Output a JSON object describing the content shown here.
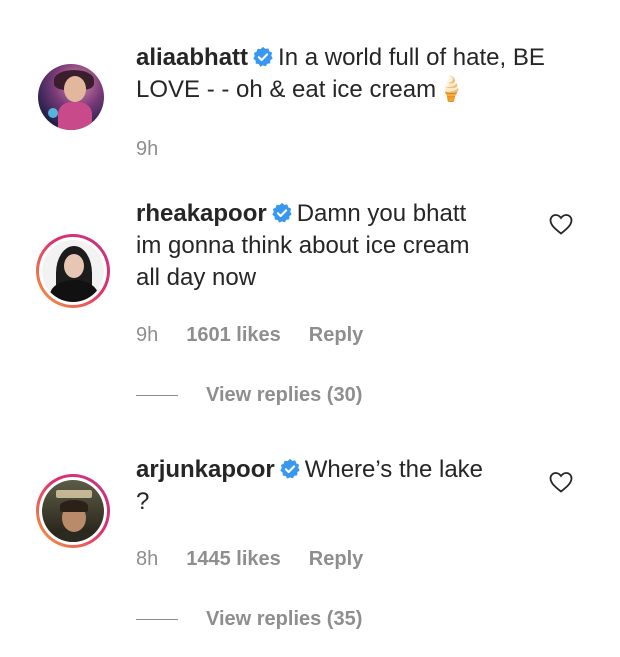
{
  "comments": [
    {
      "username": "aliaabhatt",
      "text_line1": "In a world full of hate, BE",
      "text_line2": "LOVE - - oh & eat ice cream🍦",
      "time": "9h"
    },
    {
      "username": "rheakapoor",
      "text_line1": "Damn you bhatt",
      "text_line2": "im gonna think about ice cream",
      "text_line3": "all day now",
      "time": "9h",
      "likes": "1601 likes",
      "reply": "Reply",
      "view_replies": "View replies (30)"
    },
    {
      "username": "arjunkapoor",
      "text_line1": "Where’s the lake",
      "text_line2": "?",
      "time": "8h",
      "likes": "1445 likes",
      "reply": "Reply",
      "view_replies": "View replies (35)"
    }
  ],
  "icons": {
    "verified": "verified-badge-icon",
    "like": "heart-outline-icon"
  },
  "colors": {
    "verified_blue": "#3897f0",
    "meta_gray": "#8e8e8e",
    "text": "#262626"
  }
}
